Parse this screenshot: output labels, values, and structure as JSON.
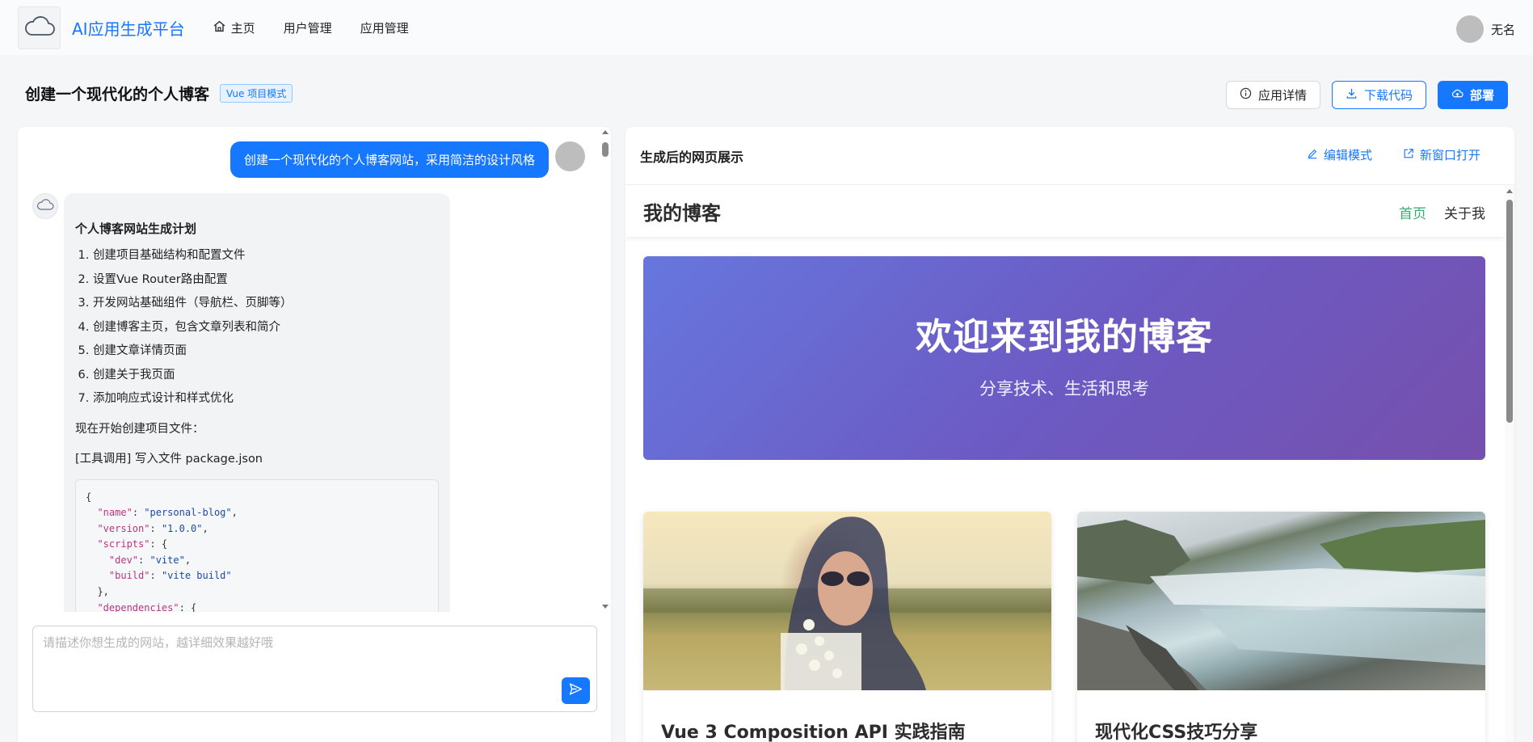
{
  "topbar": {
    "brand": "AI应用生成平台",
    "logo_icon": "cloud-icon",
    "nav": [
      {
        "label": "主页",
        "icon": "home-icon"
      },
      {
        "label": "用户管理"
      },
      {
        "label": "应用管理"
      }
    ],
    "user_name": "无名"
  },
  "header": {
    "title": "创建一个现代化的个人博客",
    "mode_tag": "Vue 项目模式",
    "actions": {
      "details": "应用详情",
      "download": "下载代码",
      "deploy": "部署"
    }
  },
  "chat": {
    "user_message": "创建一个现代化的个人博客网站，采用简洁的设计风格",
    "ai": {
      "heading": "个人博客网站生成计划",
      "steps": [
        "创建项目基础结构和配置文件",
        "设置Vue Router路由配置",
        "开发网站基础组件（导航栏、页脚等）",
        "创建博客主页，包含文章列表和简介",
        "创建文章详情页面",
        "创建关于我页面",
        "添加响应式设计和样式优化"
      ],
      "intro": "现在开始创建项目文件：",
      "tool_call": "[工具调用] 写入文件 package.json",
      "code": {
        "name_key": "\"name\"",
        "name_val": "\"personal-blog\"",
        "version_key": "\"version\"",
        "version_val": "\"1.0.0\"",
        "scripts_key": "\"scripts\"",
        "dev_key": "\"dev\"",
        "dev_val": "\"vite\"",
        "build_key": "\"build\"",
        "build_val": "\"vite build\"",
        "deps_key": "\"dependencies\""
      }
    },
    "input_placeholder": "请描述你想生成的网站，越详细效果越好哦"
  },
  "preview": {
    "title": "生成后的网页展示",
    "edit_mode": "编辑模式",
    "open_new": "新窗口打开",
    "site": {
      "brand": "我的博客",
      "links": [
        "首页",
        "关于我"
      ],
      "hero_title": "欢迎来到我的博客",
      "hero_subtitle": "分享技术、生活和思考",
      "cards": [
        {
          "title": "Vue 3 Composition API 实践指南"
        },
        {
          "title": "现代化CSS技巧分享"
        }
      ]
    }
  },
  "colors": {
    "accent": "#1677ff",
    "site_active_link": "#3aab6d",
    "hero_gradient_start": "#6677de",
    "hero_gradient_end": "#7550ad"
  }
}
